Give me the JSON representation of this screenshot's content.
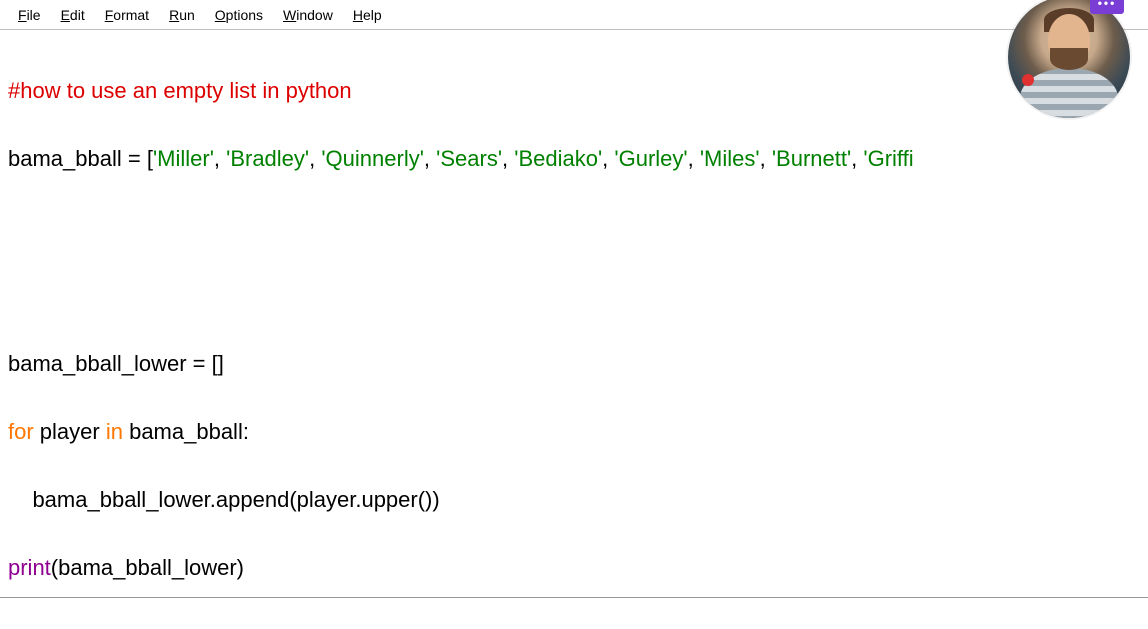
{
  "menu": {
    "file": "File",
    "edit": "Edit",
    "format": "Format",
    "run": "Run",
    "options": "Options",
    "window": "Window",
    "help": "Help"
  },
  "code": {
    "line1_comment": "#how to use an empty list in python",
    "line2_prefix": "bama_bball = [",
    "line2_s1": "'Miller'",
    "line2_c1": ", ",
    "line2_s2": "'Bradley'",
    "line2_c2": ", ",
    "line2_s3": "'Quinnerly'",
    "line2_c3": ", ",
    "line2_s4": "'Sears'",
    "line2_c4": ", ",
    "line2_s5": "'Bediako'",
    "line2_c5": ", ",
    "line2_s6": "'Gurley'",
    "line2_c6": ", ",
    "line2_s7": "'Miles'",
    "line2_c7": ", ",
    "line2_s8": "'Burnett'",
    "line2_c8": ", ",
    "line2_s9": "'Griffi",
    "line3": "bama_bball_lower = []",
    "line4_kw1": "for",
    "line4_mid1": " player ",
    "line4_kw2": "in",
    "line4_mid2": " bama_bball:",
    "line5": "    bama_bball_lower.append(player.upper())",
    "line6_builtin": "print",
    "line6_rest": "(bama_bball_lower)"
  },
  "overlay": {
    "dots": "•••"
  }
}
